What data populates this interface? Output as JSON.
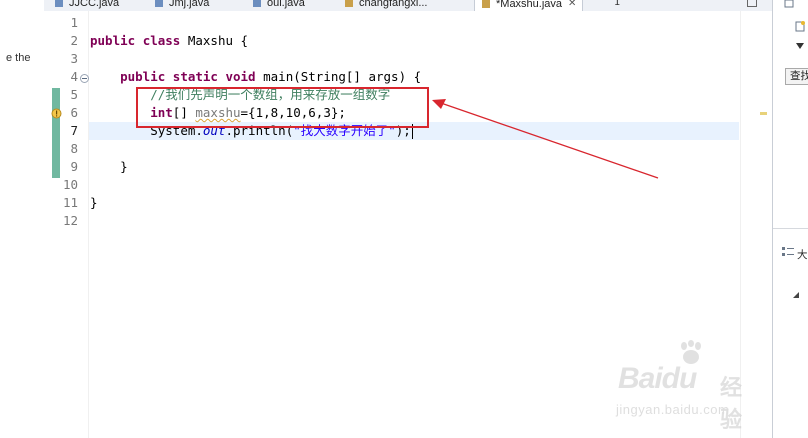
{
  "left_panel": {
    "fragment_text": "e the"
  },
  "tabs": [
    {
      "label": "JJCC.java",
      "active": false
    },
    {
      "label": "Jmj.java",
      "active": false
    },
    {
      "label": "oui.java",
      "active": false
    },
    {
      "label": "changfangxi...",
      "active": false
    },
    {
      "label": "*Maxshu.java",
      "active": true
    }
  ],
  "tab_overflow_count": "1",
  "editor": {
    "line_numbers": [
      "1",
      "2",
      "3",
      "4",
      "5",
      "6",
      "7",
      "8",
      "9",
      "10",
      "11",
      "12"
    ],
    "current_line": "7",
    "code": {
      "l2_kw_public": "public",
      "l2_kw_class": "class",
      "l2_rest": " Maxshu {",
      "l4_kw_public": "public",
      "l4_kw_static": "static",
      "l4_kw_void": "void",
      "l4_rest": " main(String[] args) {",
      "l5_comment": "//我们先声明一个数组，用来存放一组数字",
      "l6_kw_int": "int",
      "l6_brackets": "[] ",
      "l6_var": "maxshu",
      "l6_rest": "={1,8,10,6,3};",
      "l7_pre": "System.",
      "l7_field": "out",
      "l7_mid": ".println(",
      "l7_str": "\"找大数字开始了\"",
      "l7_end": ");",
      "l9_brace": "}",
      "l11_brace": "}"
    }
  },
  "right_panel": {
    "button_label": "查找",
    "outline_label": "大"
  },
  "watermark": {
    "brand": "Baidu",
    "brand_cn": "经验",
    "url": "jingyan.baidu.com"
  },
  "colors": {
    "annotation_red": "#d8262e",
    "keyword": "#7f0055",
    "comment": "#3f7f5f",
    "string": "#2a00ff",
    "field": "#0000c0",
    "current_line": "#e8f2fe"
  }
}
